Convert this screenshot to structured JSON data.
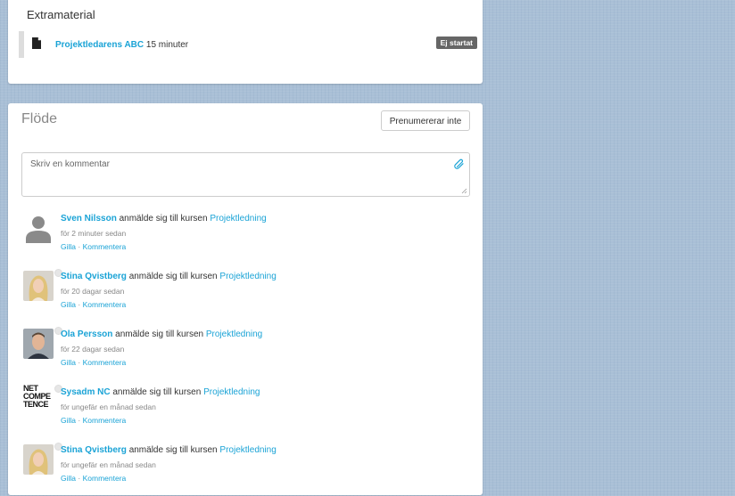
{
  "extras": {
    "title": "Extramaterial",
    "item": {
      "link_label": "Projektledarens ABC",
      "duration": "15 minuter",
      "status": "Ej startat"
    }
  },
  "feed": {
    "title": "Flöde",
    "subscribe_label": "Prenumererar inte",
    "comment_placeholder": "Skriv en kommentar",
    "items": [
      {
        "user": "Sven Nilsson",
        "action": "anmälde sig till kursen",
        "course": "Projektledning",
        "time": "för 2 minuter sedan",
        "like": "Gilla",
        "sep": "·",
        "comment": "Kommentera",
        "avatar": "placeholder"
      },
      {
        "user": "Stina Qvistberg",
        "action": "anmälde sig till kursen",
        "course": "Projektledning",
        "time": "för 20 dagar sedan",
        "like": "Gilla",
        "sep": "·",
        "comment": "Kommentera",
        "avatar": "woman"
      },
      {
        "user": "Ola Persson",
        "action": "anmälde sig till kursen",
        "course": "Projektledning",
        "time": "för 22 dagar sedan",
        "like": "Gilla",
        "sep": "·",
        "comment": "Kommentera",
        "avatar": "man"
      },
      {
        "user": "Sysadm NC",
        "action": "anmälde sig till kursen",
        "course": "Projektledning",
        "time": "för ungefär en månad sedan",
        "like": "Gilla",
        "sep": "·",
        "comment": "Kommentera",
        "avatar": "logo",
        "logo_lines": [
          "NET",
          "COMPE",
          "TENCE"
        ]
      },
      {
        "user": "Stina Qvistberg",
        "action": "anmälde sig till kursen",
        "course": "Projektledning",
        "time": "för ungefär en månad sedan",
        "like": "Gilla",
        "sep": "·",
        "comment": "Kommentera",
        "avatar": "woman"
      }
    ]
  }
}
